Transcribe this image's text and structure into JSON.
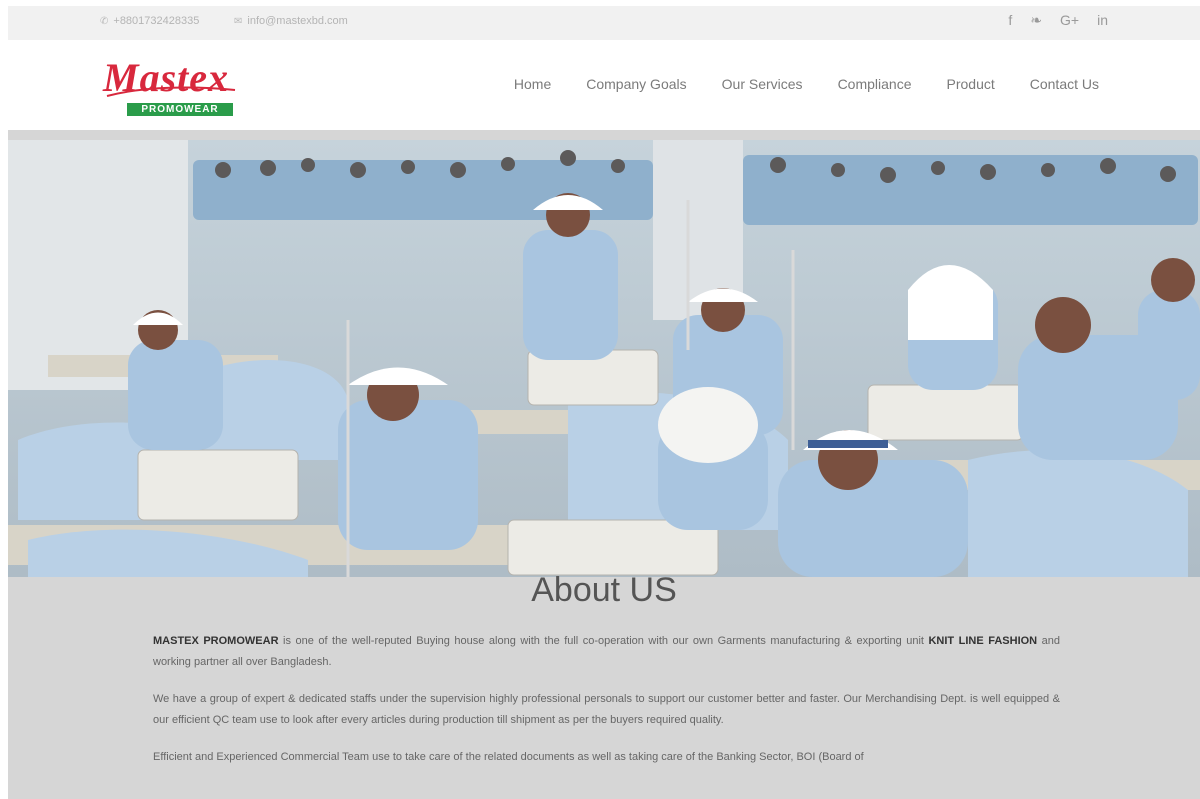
{
  "topbar": {
    "phone": "+8801732428335",
    "email": "info@mastexbd.com",
    "social": [
      {
        "icon": "facebook-icon",
        "glyph": "f"
      },
      {
        "icon": "twitter-icon",
        "glyph": "❧"
      },
      {
        "icon": "google-plus-icon",
        "glyph": "G+"
      },
      {
        "icon": "linkedin-icon",
        "glyph": "in"
      }
    ]
  },
  "header": {
    "logo_script": "Mastex",
    "logo_badge": "PROMOWEAR",
    "nav": [
      "Home",
      "Company Goals",
      "Our Services",
      "Compliance",
      "Product",
      "Contact Us"
    ]
  },
  "about": {
    "title": "About US",
    "p1_brand": "MASTEX PROMOWEAR",
    "p1_a": " is one of the well-reputed Buying house along with the full co-operation with our own Garments manufacturing & exporting unit  ",
    "p1_unit": "KNIT LINE FASHION",
    "p1_b": " and working partner all over Bangladesh.",
    "p2": "We have a group of expert & dedicated staffs under the supervision highly professional personals to support our customer better and faster. Our Merchandising Dept. is well equipped & our efficient QC team use to look after every articles during production till shipment as per the buyers required quality.",
    "p3": "Efficient and Experienced Commercial Team use to take care of the related documents as well as taking care of the Banking Sector, BOI (Board of"
  },
  "colors": {
    "brand_red": "#d8283d",
    "brand_green": "#2a9c4a",
    "uniform_blue": "#a9c5e0"
  }
}
